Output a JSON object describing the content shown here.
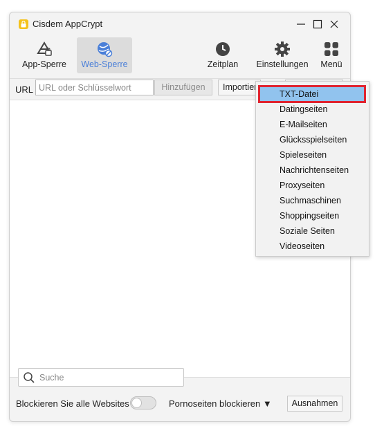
{
  "window": {
    "title": "Cisdem AppCrypt",
    "controls": [
      "minimize-icon",
      "maximize-icon",
      "close-icon"
    ]
  },
  "toolbar": {
    "app_lock": "App-Sperre",
    "web_lock": "Web-Sperre",
    "schedule": "Zeitplan",
    "settings": "Einstellungen",
    "menu": "Menü",
    "active_color": "#4a7fd8"
  },
  "urlbar": {
    "label": "URL",
    "placeholder": "URL oder Schlüsselwort",
    "add_button": "Hinzufügen",
    "import_button": "Importieren"
  },
  "search": {
    "placeholder": "Suche"
  },
  "footer": {
    "block_all": "Blockieren Sie alle Websites",
    "block_porn": "Pornoseiten blockieren ▼",
    "exceptions": "Ausnahmen"
  },
  "import_menu": {
    "items": [
      "TXT-Datei",
      "Datingseiten",
      "E-Mailseiten",
      "Glücksspielseiten",
      "Spieleseiten",
      "Nachrichtenseiten",
      "Proxyseiten",
      "Suchmaschinen",
      "Shoppingseiten",
      "Soziale Seiten",
      "Videoseiten"
    ],
    "selected": "TXT-Datei",
    "highlight_color": "#e02430"
  }
}
